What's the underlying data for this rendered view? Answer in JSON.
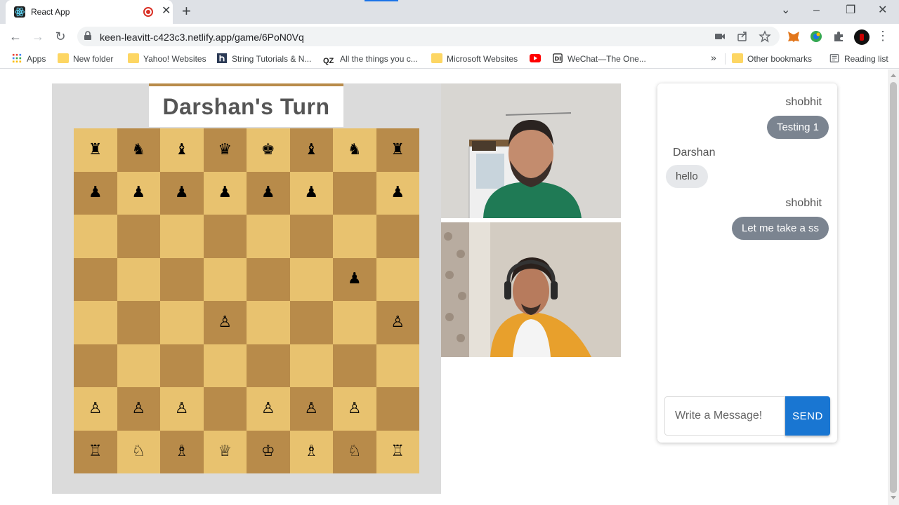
{
  "browser": {
    "tab_title": "React App",
    "url": "keen-leavitt-c423c3.netlify.app/game/6PoN0Vq",
    "bookmarks": [
      {
        "label": "Apps",
        "icon": "apps-grid-icon"
      },
      {
        "label": "New folder",
        "icon": "folder-icon"
      },
      {
        "label": "Yahoo! Websites",
        "icon": "folder-icon"
      },
      {
        "label": "String Tutorials & N...",
        "icon": "h-logo-icon"
      },
      {
        "label": "All the things you c...",
        "icon": "qz-logo-icon"
      },
      {
        "label": "Microsoft Websites",
        "icon": "folder-icon"
      },
      {
        "label": "",
        "icon": "youtube-icon"
      },
      {
        "label": "WeChat—The One...",
        "icon": "wechat-icon"
      }
    ],
    "bookmarks_overflow": "»",
    "other_bookmarks": "Other bookmarks",
    "reading_list": "Reading list"
  },
  "game": {
    "turn_text": "Darshan's Turn",
    "board": [
      [
        "♜",
        "♞",
        "♝",
        "♛",
        "♚",
        "♝",
        "♞",
        "♜"
      ],
      [
        "♟",
        "♟",
        "♟",
        "♟",
        "♟",
        "♟",
        "",
        "♟"
      ],
      [
        "",
        "",
        "",
        "",
        "",
        "",
        "",
        ""
      ],
      [
        "",
        "",
        "",
        "",
        "",
        "",
        "♟",
        ""
      ],
      [
        "",
        "",
        "",
        "♙",
        "",
        "",
        "",
        "♙"
      ],
      [
        "",
        "",
        "",
        "",
        "",
        "",
        "",
        ""
      ],
      [
        "♙",
        "♙",
        "♙",
        "",
        "♙",
        "♙",
        "♙",
        ""
      ],
      [
        "♖",
        "♘",
        "♗",
        "♕",
        "♔",
        "♗",
        "♘",
        "♖"
      ]
    ],
    "colors": {
      "light": "#e8c26f",
      "dark": "#b88b4a",
      "banner_accent": "#b88b4a"
    }
  },
  "chat": {
    "messages": [
      {
        "sender": "shobhit",
        "text": "Testing 1",
        "own": true
      },
      {
        "sender": "Darshan",
        "text": "hello",
        "own": false
      },
      {
        "sender": "shobhit",
        "text": "Let me take a ss",
        "own": true
      }
    ],
    "input_placeholder": "Write a Message!",
    "send_label": "SEND"
  }
}
